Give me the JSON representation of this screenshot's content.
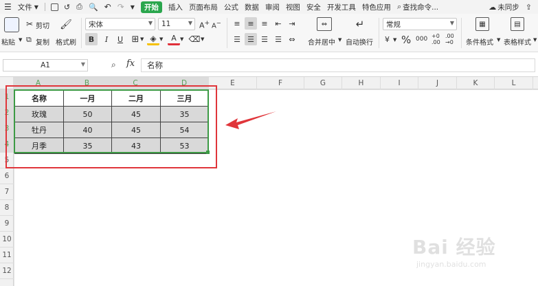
{
  "menu": {
    "file": "文件",
    "start": "开始",
    "insert": "插入",
    "page_layout": "页面布局",
    "formula": "公式",
    "data": "数据",
    "review": "审阅",
    "view": "视图",
    "security": "安全",
    "developer": "开发工具",
    "features": "特色应用",
    "search": "查找命令...",
    "sync": "未同步"
  },
  "ribbon": {
    "paste": "粘贴",
    "cut": "剪切",
    "copy": "复制",
    "format_painter": "格式刷",
    "font_name": "宋体",
    "font_size": "11",
    "bold": "B",
    "italic": "I",
    "underline": "U",
    "font_color_glyph": "A",
    "merge_center": "合并居中",
    "wrap_text": "自动换行",
    "number_format": "常规",
    "percent": "%",
    "thousands": "000",
    "cond_format": "条件格式",
    "table_style": "表格样式"
  },
  "formula_bar": {
    "name_box": "A1",
    "fx": "fx",
    "content": "名称"
  },
  "columns": [
    "A",
    "B",
    "C",
    "D",
    "E",
    "F",
    "G",
    "H",
    "I",
    "J",
    "K",
    "L"
  ],
  "rows": [
    "1",
    "2",
    "3",
    "4",
    "5",
    "6",
    "7",
    "8",
    "9",
    "10",
    "11",
    "12"
  ],
  "table": {
    "header": [
      "名称",
      "一月",
      "二月",
      "三月"
    ],
    "rows": [
      [
        "玫瑰",
        "50",
        "45",
        "35"
      ],
      [
        "牡丹",
        "40",
        "45",
        "54"
      ],
      [
        "月季",
        "35",
        "43",
        "53"
      ]
    ]
  },
  "watermark": {
    "brand": "Bai 经验",
    "url": "jingyan.baidu.com"
  },
  "colors": {
    "start_tab": "#2aa64d",
    "selection": "#3c9a44",
    "annotation": "#e0353a"
  }
}
